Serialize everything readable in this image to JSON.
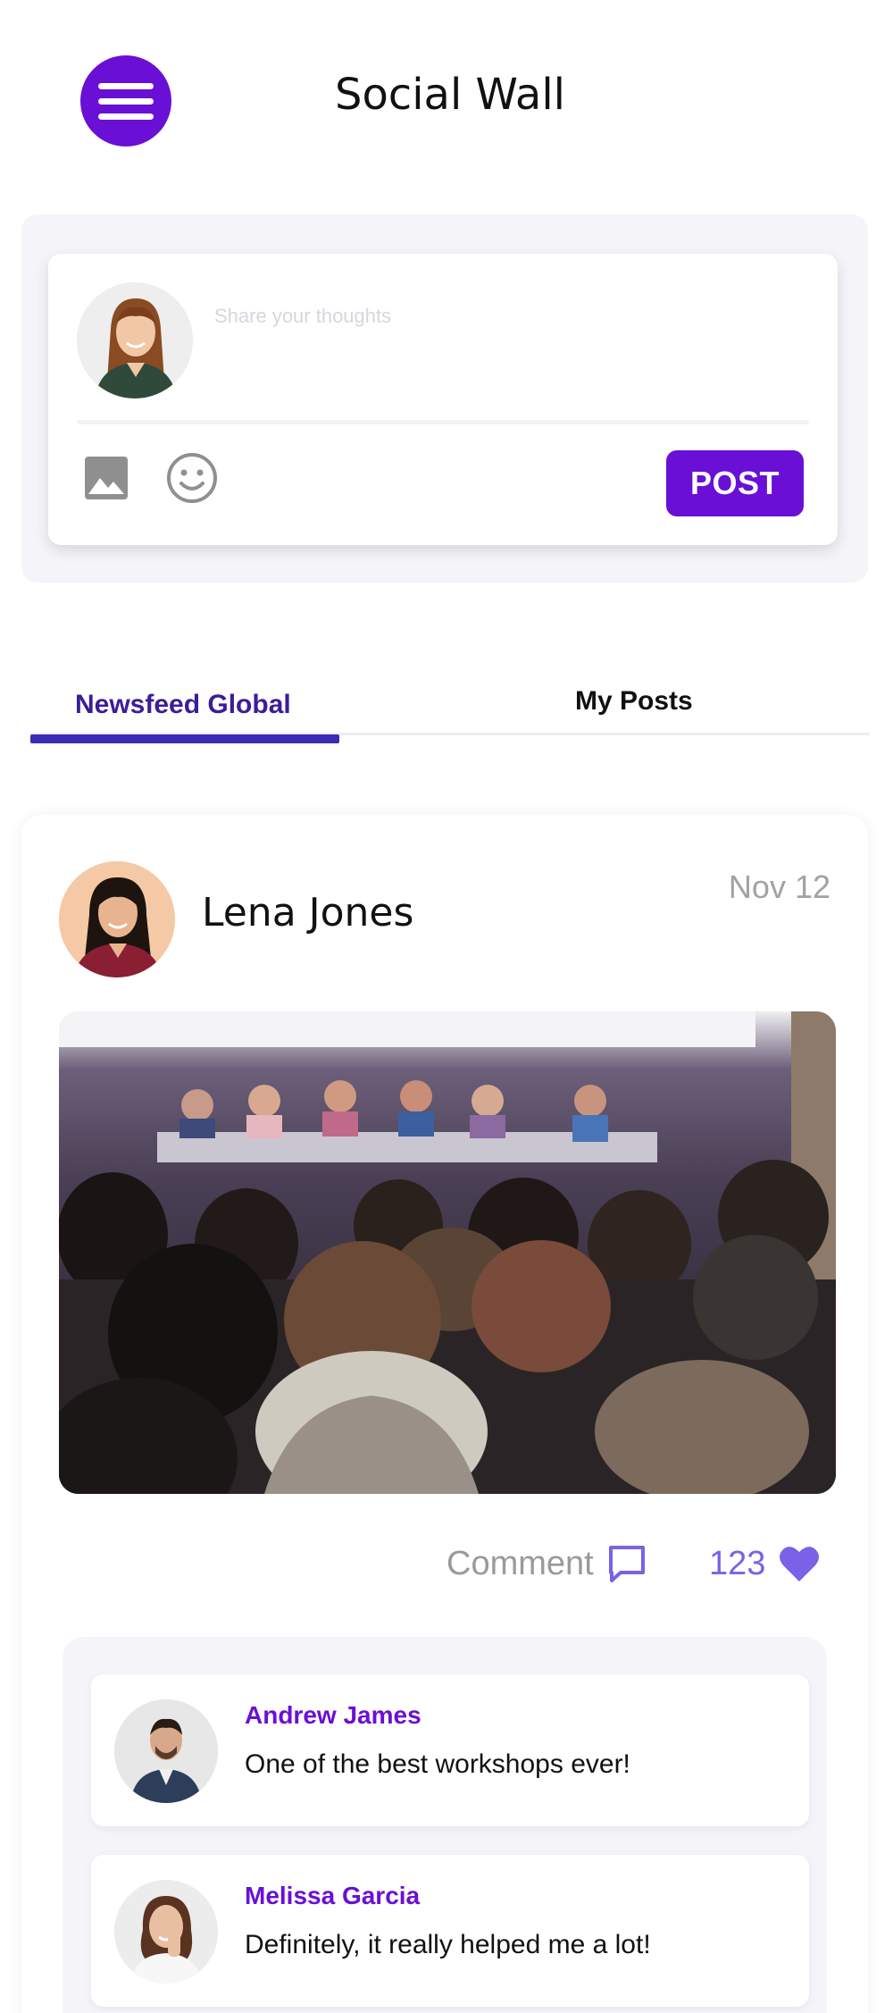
{
  "header": {
    "title": "Social Wall",
    "menu_icon": "hamburger-menu-icon"
  },
  "composer": {
    "placeholder": "Share your thoughts",
    "post_label": "POST",
    "icons": [
      "image-icon",
      "emoji-icon"
    ]
  },
  "tabs": [
    {
      "label": "Newsfeed Global",
      "active": true
    },
    {
      "label": "My Posts",
      "active": false
    }
  ],
  "post": {
    "author": "Lena Jones",
    "date": "Nov 12",
    "comment_label": "Comment",
    "like_count": "123",
    "comments": [
      {
        "author": "Andrew James",
        "text": "One of the best workshops ever!"
      },
      {
        "author": "Melissa Garcia",
        "text": "Definitely, it really helped me a lot!"
      }
    ]
  },
  "colors": {
    "accent": "#6a0fd6",
    "tab_active": "#3d2bb3",
    "like": "#7a62e8",
    "muted": "#9a9a9a"
  }
}
